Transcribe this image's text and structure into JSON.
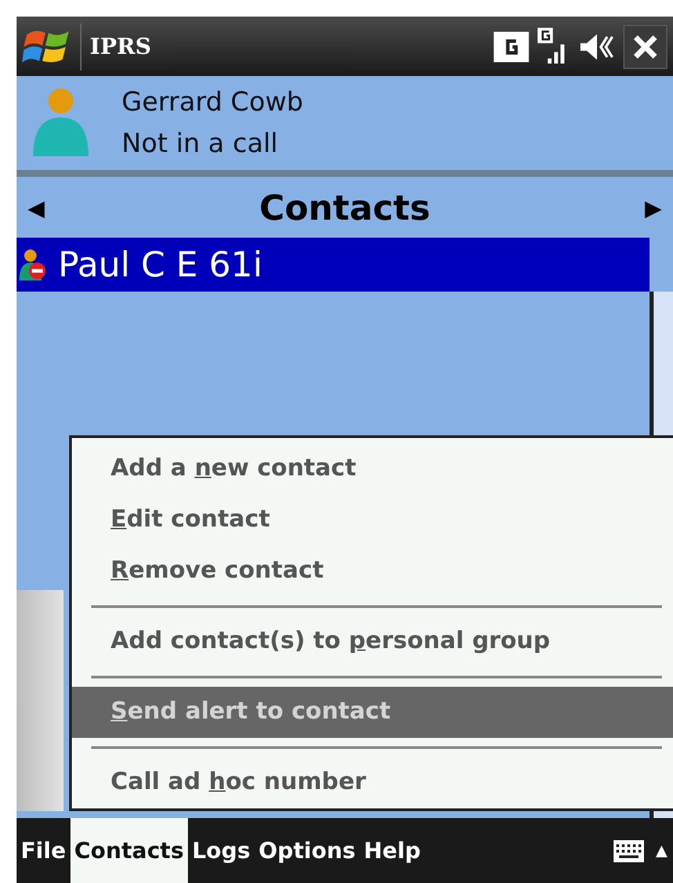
{
  "window": {
    "title": "IPRS"
  },
  "user": {
    "name": "Gerrard Cowb",
    "status": "Not in a call"
  },
  "header": {
    "title": "Contacts",
    "prev": "◀",
    "next": "▶"
  },
  "contacts": [
    {
      "name": "Paul C E 61i",
      "selected": true
    }
  ],
  "menu": [
    {
      "kind": "item",
      "pre": "Add a ",
      "key": "n",
      "post": "ew contact",
      "selected": false,
      "disabled": false
    },
    {
      "kind": "item",
      "key": "E",
      "post": "dit contact",
      "selected": false,
      "disabled": false
    },
    {
      "kind": "item",
      "key": "R",
      "post": "emove contact",
      "selected": false,
      "disabled": false
    },
    {
      "kind": "separator"
    },
    {
      "kind": "item",
      "pre": "Add contact(s) to ",
      "key": "p",
      "post": "ersonal group",
      "selected": false,
      "disabled": false
    },
    {
      "kind": "separator"
    },
    {
      "kind": "item",
      "key": "S",
      "post": "end alert to contact",
      "selected": true,
      "disabled": true
    },
    {
      "kind": "separator"
    },
    {
      "kind": "item",
      "pre": "Call ad ",
      "key": "h",
      "post": "oc number",
      "selected": false,
      "disabled": false
    }
  ],
  "menubar": [
    {
      "label": "File",
      "selected": false
    },
    {
      "label": "Contacts",
      "selected": true
    },
    {
      "label": "Logs",
      "selected": false
    },
    {
      "label": "Options",
      "selected": false
    },
    {
      "label": "Help",
      "selected": false
    }
  ],
  "menubar_arrow": "▲"
}
